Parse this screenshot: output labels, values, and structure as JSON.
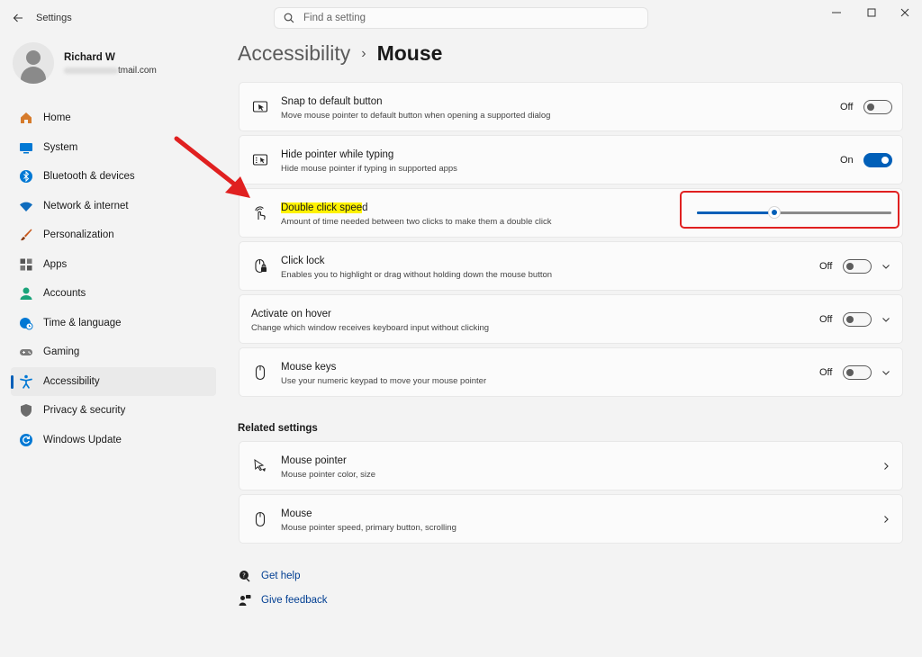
{
  "window": {
    "title": "Settings",
    "controls": [
      "minimize",
      "maximize",
      "close"
    ]
  },
  "search": {
    "placeholder": "Find a setting"
  },
  "profile": {
    "name": "Richard W",
    "email_suffix": "tmail.com"
  },
  "sidebar": {
    "items": [
      {
        "label": "Home",
        "icon": "home-icon",
        "color": "#d67b2b"
      },
      {
        "label": "System",
        "icon": "system-icon",
        "color": "#0078d4"
      },
      {
        "label": "Bluetooth & devices",
        "icon": "bluetooth-icon",
        "color": "#0078d4"
      },
      {
        "label": "Network & internet",
        "icon": "wifi-icon",
        "color": "#0f6cbd"
      },
      {
        "label": "Personalization",
        "icon": "brush-icon",
        "color": "#c85a1e"
      },
      {
        "label": "Apps",
        "icon": "apps-icon",
        "color": "#555555"
      },
      {
        "label": "Accounts",
        "icon": "accounts-icon",
        "color": "#1aa37a"
      },
      {
        "label": "Time & language",
        "icon": "globe-clock-icon",
        "color": "#0078d4"
      },
      {
        "label": "Gaming",
        "icon": "gamepad-icon",
        "color": "#7a7a7a"
      },
      {
        "label": "Accessibility",
        "icon": "accessibility-icon",
        "color": "#0078d4",
        "active": true
      },
      {
        "label": "Privacy & security",
        "icon": "shield-icon",
        "color": "#6b6b6b"
      },
      {
        "label": "Windows Update",
        "icon": "update-icon",
        "color": "#0078d4"
      }
    ]
  },
  "breadcrumb": {
    "parent": "Accessibility",
    "separator": "›",
    "current": "Mouse"
  },
  "settings": {
    "snap": {
      "title": "Snap to default button",
      "subtitle": "Move mouse pointer to default button when opening a supported dialog",
      "state": "Off"
    },
    "hide_pointer": {
      "title": "Hide pointer while typing",
      "subtitle": "Hide mouse pointer if typing in supported apps",
      "state": "On"
    },
    "double_click": {
      "title_highlighted": "Double click spee",
      "title_rest": "d",
      "subtitle": "Amount of time needed between two clicks to make them a double click",
      "slider_fraction": 0.4
    },
    "click_lock": {
      "title": "Click lock",
      "subtitle": "Enables you to highlight or drag without holding down the mouse button",
      "state": "Off"
    },
    "activate_hover": {
      "title": "Activate on hover",
      "subtitle": "Change which window receives keyboard input without clicking",
      "state": "Off"
    },
    "mouse_keys": {
      "title": "Mouse keys",
      "subtitle": "Use your numeric keypad to move your mouse pointer",
      "state": "Off"
    }
  },
  "related": {
    "title": "Related settings",
    "mouse_pointer": {
      "title": "Mouse pointer",
      "subtitle": "Mouse pointer color, size"
    },
    "mouse": {
      "title": "Mouse",
      "subtitle": "Mouse pointer speed, primary button, scrolling"
    }
  },
  "links": {
    "get_help": "Get help",
    "give_feedback": "Give feedback"
  },
  "colors": {
    "accent": "#005fb8",
    "annotation": "#e02020",
    "highlight": "#fff200"
  }
}
